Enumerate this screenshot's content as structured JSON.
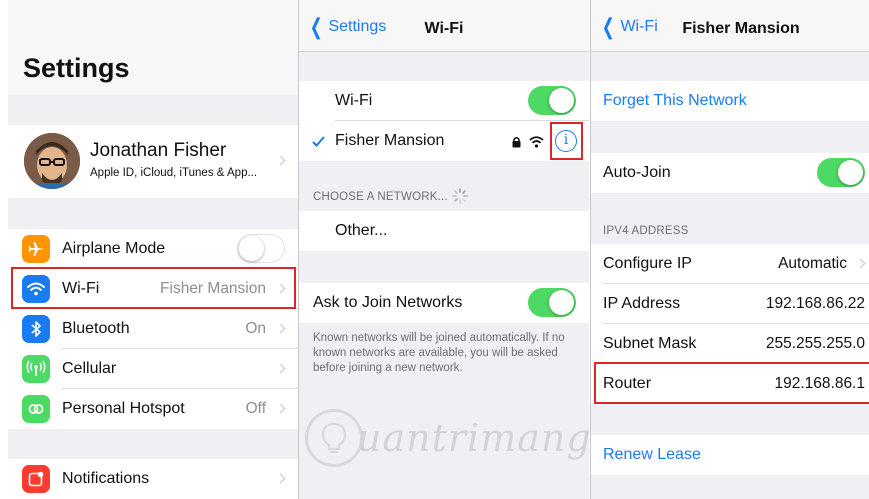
{
  "settings": {
    "title": "Settings",
    "profile": {
      "name": "Jonathan Fisher",
      "subtitle": "Apple ID, iCloud, iTunes & App..."
    },
    "items": [
      {
        "label": "Airplane Mode",
        "value": "",
        "icon": "airplane-icon",
        "color": "#ff9500"
      },
      {
        "label": "Wi-Fi",
        "value": "Fisher Mansion",
        "icon": "wifi-icon",
        "color": "#1a7cf5"
      },
      {
        "label": "Bluetooth",
        "value": "On",
        "icon": "bluetooth-icon",
        "color": "#1a7cf5"
      },
      {
        "label": "Cellular",
        "value": "",
        "icon": "cellular-icon",
        "color": "#4cd964"
      },
      {
        "label": "Personal Hotspot",
        "value": "Off",
        "icon": "hotspot-icon",
        "color": "#4cd964"
      },
      {
        "label": "Notifications",
        "value": "",
        "icon": "notifications-icon",
        "color": "#ff3b30"
      }
    ]
  },
  "wifi": {
    "back": "Settings",
    "title": "Wi-Fi",
    "toggle_label": "Wi-Fi",
    "network": "Fisher Mansion",
    "choose_header": "CHOOSE A NETWORK...",
    "other": "Other...",
    "ask_label": "Ask to Join Networks",
    "footnote": "Known networks will be joined automatically. If no known networks are available, you will be asked before joining a new network."
  },
  "detail": {
    "back": "Wi-Fi",
    "title": "Fisher Mansion",
    "forget": "Forget This Network",
    "auto_join": "Auto-Join",
    "ipv4_header": "IPV4 ADDRESS",
    "rows": [
      {
        "label": "Configure IP",
        "value": "Automatic"
      },
      {
        "label": "IP Address",
        "value": "192.168.86.22"
      },
      {
        "label": "Subnet Mask",
        "value": "255.255.255.0"
      },
      {
        "label": "Router",
        "value": "192.168.86.1"
      }
    ],
    "renew": "Renew Lease"
  },
  "watermark": "uantrimang",
  "colors": {
    "accent": "#1a7cf5",
    "toggle_on": "#4cd964",
    "highlight": "#d9262b",
    "background": "#efeff4"
  }
}
